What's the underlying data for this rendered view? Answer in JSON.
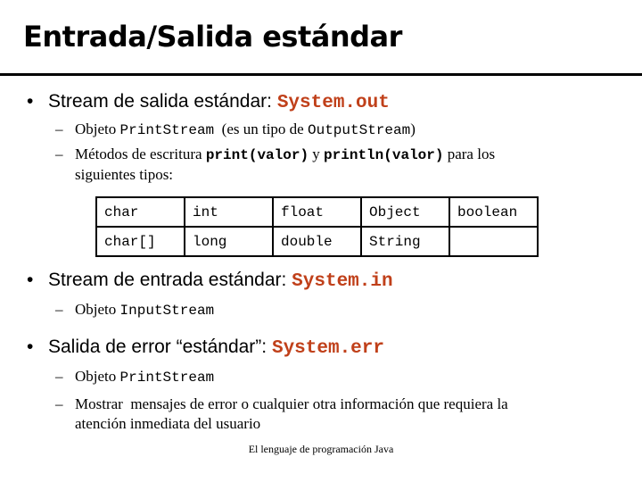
{
  "slide": {
    "title": "Entrada/Salida estándar",
    "footer": "El lenguaje de programación Java",
    "accent_color": "#c0401a"
  },
  "bullets": [
    {
      "text": "Stream de salida estándar: ",
      "code": "System.out",
      "subitems": [
        {
          "parts": [
            "Objeto ",
            "PrintStream",
            "  (es un tipo de ",
            "OutputStream",
            ")"
          ]
        },
        {
          "parts": [
            "Métodos de escritura ",
            "print(valor)",
            " y ",
            "println(valor)",
            " para los"
          ],
          "continuation": "siguientes tipos:"
        }
      ]
    },
    {
      "text": "Stream de entrada estándar: ",
      "code": "System.in",
      "subitems": [
        {
          "parts": [
            "Objeto ",
            "InputStream"
          ]
        }
      ]
    },
    {
      "text": "Salida de error “estándar”: ",
      "code": "System.err",
      "subitems": [
        {
          "parts": [
            "Objeto ",
            "PrintStream"
          ]
        },
        {
          "parts": [
            "Mostrar  mensajes de error o cualquier otra información que requiera la"
          ],
          "continuation": "atención inmediata del usuario"
        }
      ]
    }
  ],
  "types_table": {
    "rows": [
      [
        "char",
        "int",
        "float",
        "Object",
        "boolean"
      ],
      [
        "char[]",
        "long",
        "double",
        "String",
        ""
      ]
    ]
  }
}
